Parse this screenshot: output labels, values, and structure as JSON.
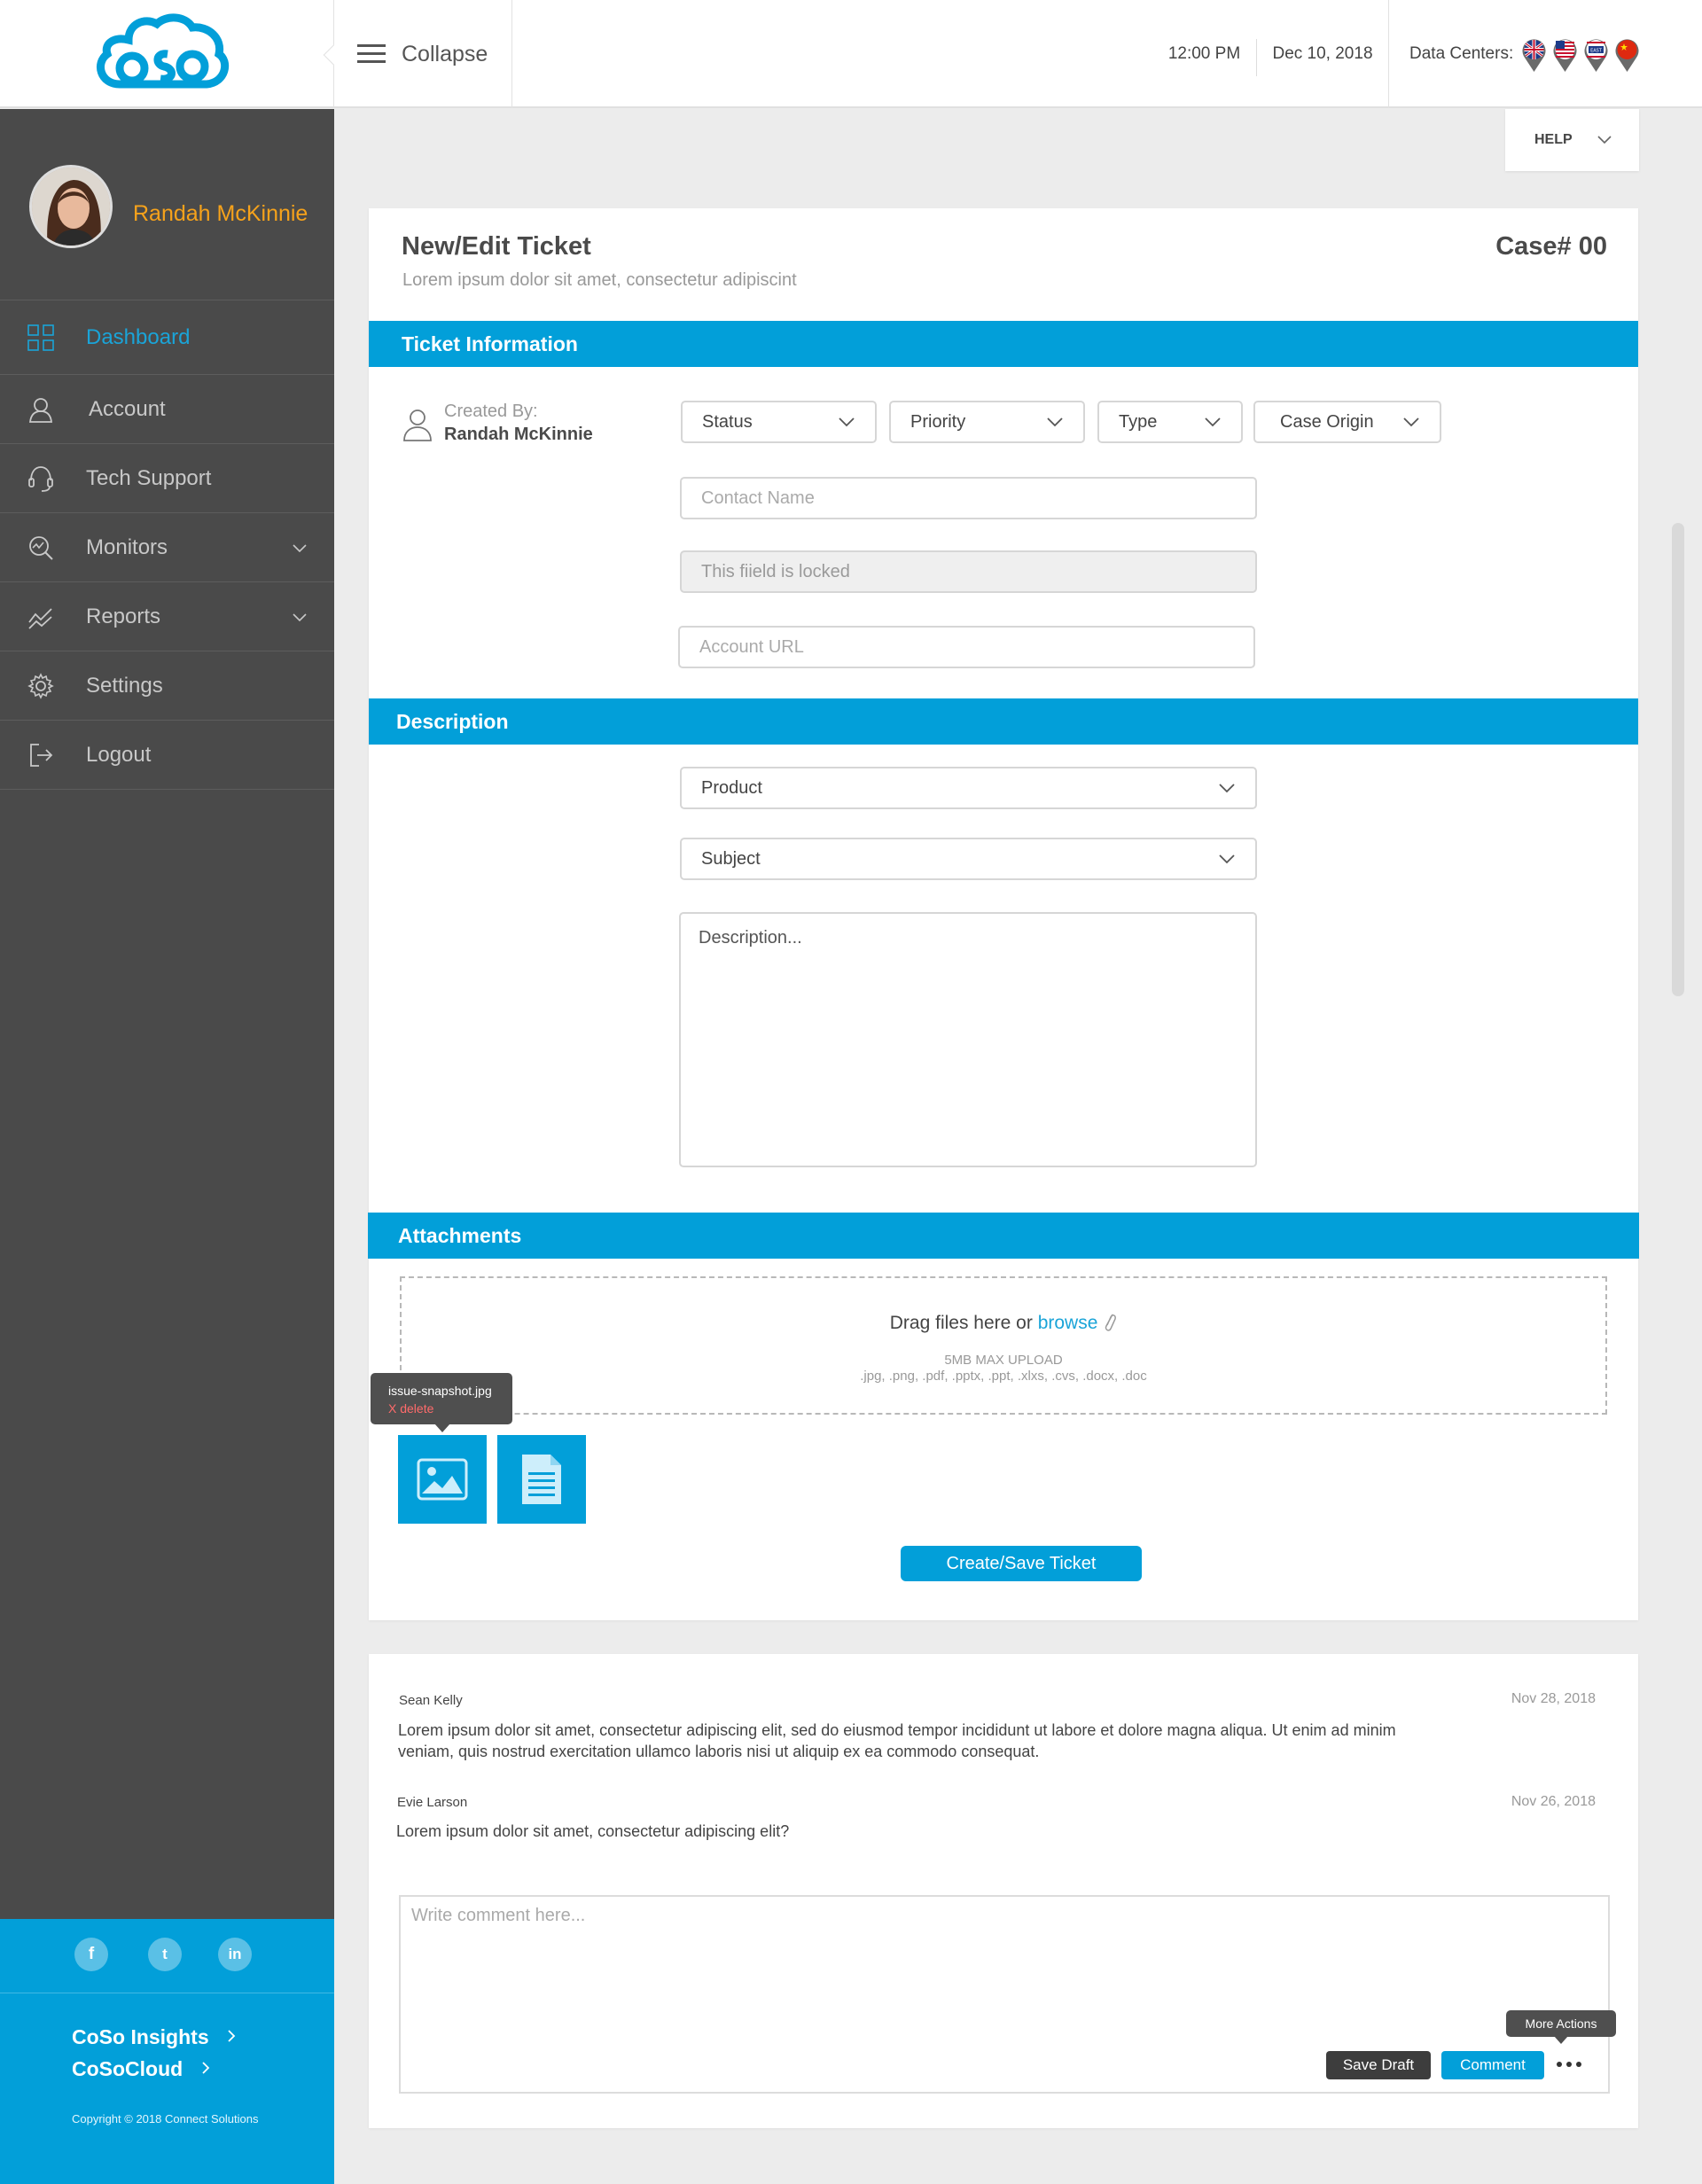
{
  "header": {
    "collapse_label": "Collapse",
    "time": "12:00 PM",
    "date": "Dec 10, 2018",
    "data_centers_label": "Data Centers:",
    "data_centers": [
      "uk-flag",
      "us-flag",
      "us-east-flag",
      "china-flag"
    ]
  },
  "sidebar": {
    "user_name": "Randah McKinnie",
    "items": [
      {
        "label": "Dashboard",
        "icon": "dashboard-icon",
        "active": true
      },
      {
        "label": "Account",
        "icon": "account-icon"
      },
      {
        "label": "Tech Support",
        "icon": "headset-icon"
      },
      {
        "label": "Monitors",
        "icon": "monitor-icon",
        "expandable": true
      },
      {
        "label": "Reports",
        "icon": "reports-icon",
        "expandable": true
      },
      {
        "label": "Settings",
        "icon": "gear-icon"
      },
      {
        "label": "Logout",
        "icon": "logout-icon"
      }
    ],
    "social": [
      "f",
      "t",
      "in"
    ],
    "links": [
      "CoSo Insights",
      "CoSoCloud"
    ],
    "copyright": "Copyright © 2018 Connect Solutions"
  },
  "help": {
    "label": "HELP"
  },
  "ticket": {
    "title": "New/Edit Ticket",
    "subtitle": "Lorem ipsum dolor sit amet, consectetur adipiscint",
    "case_number": "Case# 00",
    "sections": {
      "info": "Ticket Information",
      "description": "Description",
      "attachments": "Attachments"
    },
    "created_by_label": "Created By:",
    "created_by_name": "Randah McKinnie",
    "selects": {
      "status": "Status",
      "priority": "Priority",
      "type": "Type",
      "case_origin": "Case Origin",
      "product": "Product",
      "subject": "Subject"
    },
    "fields": {
      "contact_name": "Contact Name",
      "locked": "This fiield is locked",
      "account_url": "Account URL",
      "description": "Description..."
    },
    "upload": {
      "drag_text": "Drag files here or",
      "browse": "browse",
      "max": "5MB MAX UPLOAD",
      "formats": ".jpg, .png, .pdf, .pptx, .ppt, .xlxs, .cvs, .docx, .doc"
    },
    "attachment_tooltip": {
      "filename": "issue-snapshot.jpg",
      "delete": "X delete"
    },
    "save_button": "Create/Save Ticket"
  },
  "comments": {
    "items": [
      {
        "author": "Sean Kelly",
        "date": "Nov 28, 2018",
        "text": "Lorem ipsum dolor sit amet, consectetur adipiscing elit, sed do eiusmod tempor incididunt ut labore et dolore magna aliqua. Ut enim ad minim veniam, quis nostrud exercitation ullamco laboris nisi ut aliquip ex ea commodo consequat."
      },
      {
        "author": "Evie Larson",
        "date": "Nov 26, 2018",
        "text": "Lorem ipsum dolor sit amet, consectetur adipiscing elit?"
      }
    ],
    "placeholder": "Write comment here...",
    "save_draft": "Save Draft",
    "comment_button": "Comment",
    "more_actions": "More Actions"
  },
  "colors": {
    "accent": "#029fd9",
    "sidebar": "#4a4a4a",
    "name_orange": "#f6a21b"
  }
}
